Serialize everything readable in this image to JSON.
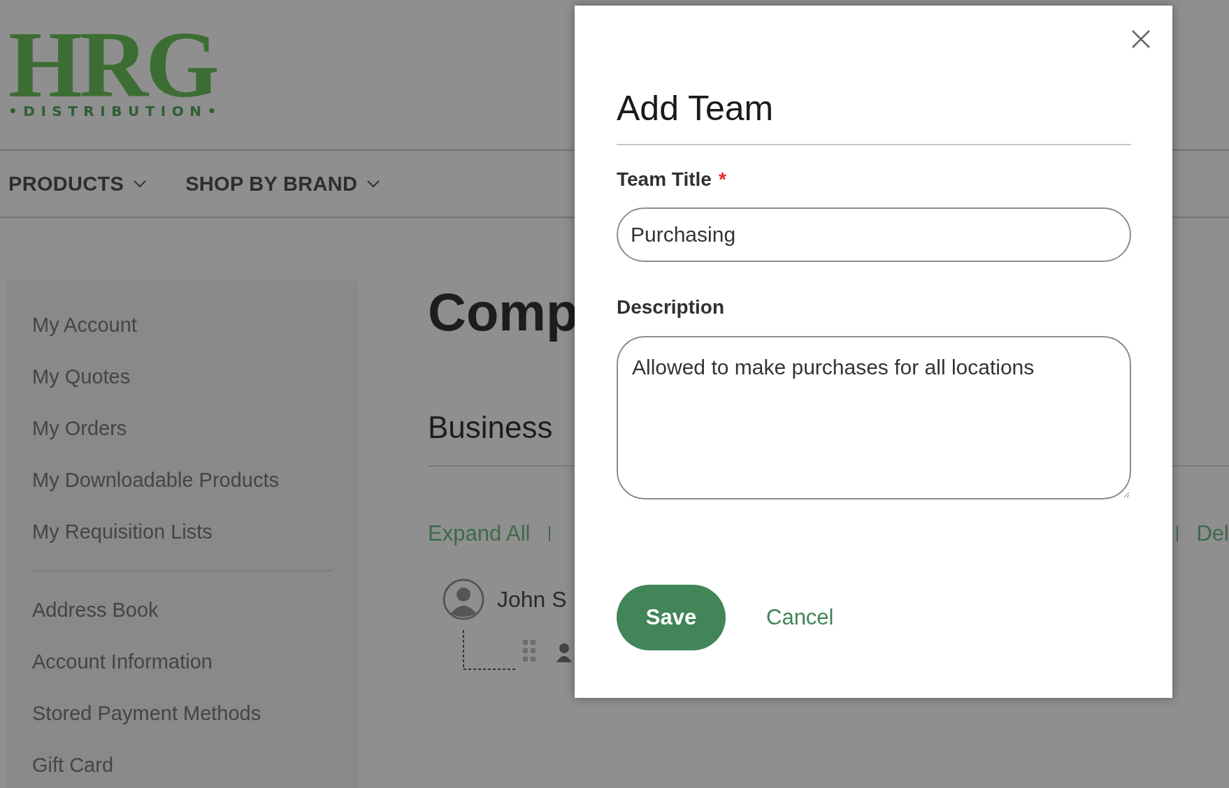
{
  "logo": {
    "wordmark": "HRG",
    "tagline": "•DISTRIBUTION•"
  },
  "nav": [
    {
      "label": "PRODUCTS"
    },
    {
      "label": "SHOP BY BRAND"
    }
  ],
  "sidebar": {
    "sections": [
      {
        "items": [
          "My Account",
          "My Quotes",
          "My Orders",
          "My Downloadable Products",
          "My Requisition Lists"
        ]
      },
      {
        "items": [
          "Address Book",
          "Account Information",
          "Stored Payment Methods",
          "Gift Card"
        ]
      }
    ]
  },
  "main": {
    "title": "Comp",
    "subtitle": "Business",
    "actions_left": [
      "Expand All"
    ],
    "actions_right": [
      "Del"
    ],
    "tree": {
      "name": "John S"
    }
  },
  "modal": {
    "title": "Add Team",
    "fields": [
      {
        "kind": "input",
        "label": "Team Title",
        "required_mark": "*",
        "value": "Purchasing"
      },
      {
        "kind": "textarea",
        "label": "Description",
        "value": "Allowed to make purchases for all locations"
      }
    ],
    "buttons": [
      {
        "kind": "primary",
        "label": "Save"
      },
      {
        "kind": "link",
        "label": "Cancel"
      }
    ]
  }
}
